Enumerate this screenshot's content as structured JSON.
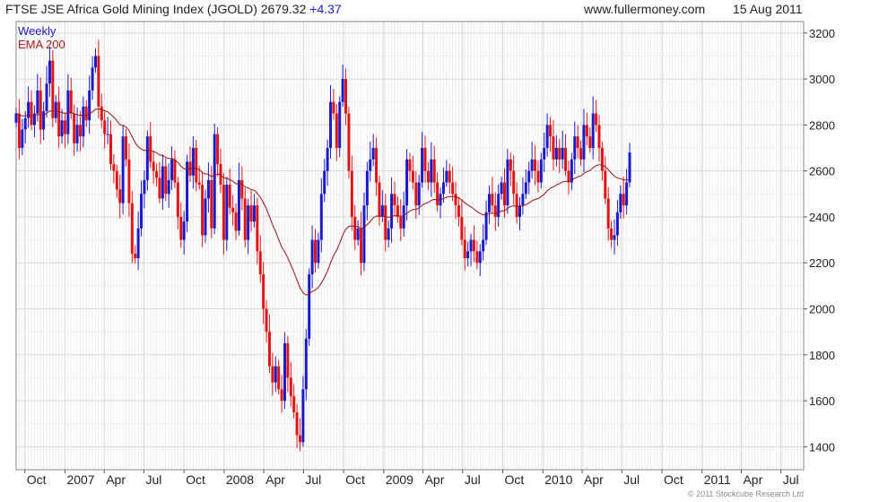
{
  "header": {
    "title": "FTSE JSE Africa Gold Mining Index (JGOLD) 2679.32",
    "change": "+4.37",
    "site": "www.fullermoney.com",
    "date": "15 Aug 2011"
  },
  "copyright": "© 2011 Stockcube Research Ltd",
  "colors": {
    "up": "#1a1acc",
    "down": "#e01414",
    "ema": "#9b1111",
    "grid": "#d8d8d8"
  },
  "chart_data": {
    "type": "bar",
    "chart_style": "weekly OHLC bars with EMA overlay",
    "legend": [
      {
        "label": "Weekly"
      },
      {
        "label": "EMA 200"
      }
    ],
    "y_axis": {
      "side": "right",
      "range": [
        1300,
        3250
      ],
      "ticks": [
        1400,
        1600,
        1800,
        2000,
        2200,
        2400,
        2600,
        2800,
        3000,
        3200
      ]
    },
    "x_axis": {
      "range": [
        "2006-09-11",
        "2011-08-22"
      ],
      "labels": [
        {
          "text": "Oct",
          "date": "2006-10-01"
        },
        {
          "text": "2007",
          "date": "2007-01-01"
        },
        {
          "text": "Apr",
          "date": "2007-04-01"
        },
        {
          "text": "Jul",
          "date": "2007-07-01"
        },
        {
          "text": "Oct",
          "date": "2007-10-01"
        },
        {
          "text": "2008",
          "date": "2008-01-01"
        },
        {
          "text": "Apr",
          "date": "2008-04-01"
        },
        {
          "text": "Jul",
          "date": "2008-07-01"
        },
        {
          "text": "Oct",
          "date": "2008-10-01"
        },
        {
          "text": "2009",
          "date": "2009-01-01"
        },
        {
          "text": "Apr",
          "date": "2009-04-01"
        },
        {
          "text": "Jul",
          "date": "2009-07-01"
        },
        {
          "text": "Oct",
          "date": "2009-10-01"
        },
        {
          "text": "2010",
          "date": "2010-01-01"
        },
        {
          "text": "Apr",
          "date": "2010-04-01"
        },
        {
          "text": "Jul",
          "date": "2010-07-01"
        },
        {
          "text": "Oct",
          "date": "2010-10-01"
        },
        {
          "text": "2011",
          "date": "2011-01-01"
        },
        {
          "text": "Apr",
          "date": "2011-04-01"
        },
        {
          "text": "Jul",
          "date": "2011-07-01"
        }
      ]
    },
    "start_date": "2006-09-11",
    "closes": [
      2850,
      2700,
      2780,
      2830,
      2900,
      2800,
      2850,
      2950,
      2780,
      2860,
      2980,
      3080,
      2830,
      2900,
      2750,
      2820,
      2760,
      2950,
      2850,
      2720,
      2800,
      2750,
      2880,
      2820,
      2950,
      3050,
      3100,
      2880,
      2820,
      2760,
      2760,
      2630,
      2600,
      2520,
      2460,
      2750,
      2650,
      2460,
      2240,
      2220,
      2350,
      2500,
      2560,
      2750,
      2640,
      2600,
      2570,
      2480,
      2620,
      2500,
      2560,
      2650,
      2550,
      2400,
      2300,
      2380,
      2640,
      2580,
      2700,
      2550,
      2540,
      2320,
      2480,
      2560,
      2350,
      2760,
      2630,
      2540,
      2300,
      2540,
      2440,
      2420,
      2340,
      2560,
      2480,
      2300,
      2450,
      2380,
      2450,
      2250,
      2150,
      2000,
      1900,
      1750,
      1680,
      1750,
      1650,
      1600,
      1850,
      1700,
      1620,
      1550,
      1450,
      1420,
      1650,
      1870,
      2150,
      2300,
      2200,
      2300,
      2500,
      2600,
      2700,
      2900,
      2850,
      2700,
      2900,
      3000,
      2850,
      2600,
      2400,
      2300,
      2350,
      2200,
      2450,
      2600,
      2650,
      2700,
      2550,
      2400,
      2450,
      2300,
      2350,
      2500,
      2450,
      2400,
      2350,
      2450,
      2650,
      2600,
      2550,
      2450,
      2550,
      2700,
      2600,
      2550,
      2650,
      2550,
      2450,
      2500,
      2550,
      2600,
      2550,
      2500,
      2450,
      2400,
      2300,
      2220,
      2250,
      2300,
      2250,
      2200,
      2250,
      2300,
      2420,
      2500,
      2450,
      2400,
      2500,
      2550,
      2450,
      2650,
      2600,
      2500,
      2400,
      2450,
      2500,
      2550,
      2600,
      2650,
      2600,
      2550,
      2650,
      2700,
      2800,
      2750,
      2650,
      2700,
      2650,
      2700,
      2600,
      2550,
      2650,
      2750,
      2700,
      2650,
      2800,
      2750,
      2700,
      2850,
      2800,
      2700,
      2600,
      2480,
      2350,
      2300,
      2320,
      2420,
      2500,
      2450,
      2550,
      2680
    ]
  }
}
